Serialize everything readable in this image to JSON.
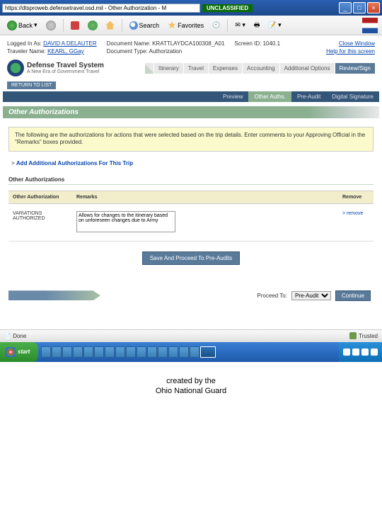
{
  "titlebar": {
    "address": "https://dtsproweb.defensetravel.osd.mil - Other Authorization - M",
    "classification": "UNCLASSIFIED"
  },
  "toolbar": {
    "back": "Back",
    "search": "Search",
    "favorites": "Favorites"
  },
  "topinfo": {
    "logged_label": "Logged In As:",
    "logged_value": "DAVID A DELAUTER",
    "traveler_label": "Traveler Name:",
    "traveler_value": "KEARL, GGay",
    "docname_label": "Document Name:",
    "docname_value": "KRATTLAYDCA100308_A01",
    "doctype_label": "Document Type:",
    "doctype_value": "Authorization",
    "screen_label": "Screen ID:",
    "screen_value": "1040.1",
    "close": "Close Window",
    "help": "Help for this screen"
  },
  "dts": {
    "title": "Defense Travel System",
    "sub": "A New Era of Government Travel",
    "return": "RETURN TO LIST"
  },
  "nav": {
    "itinerary": "Itinerary",
    "travel": "Travel",
    "expenses": "Expenses",
    "accounting": "Accounting",
    "additional": "Additional Options",
    "review": "Review/Sign"
  },
  "subnav": {
    "preview": "Preview",
    "other": "Other Auths.",
    "preaudit": "Pre-Audit",
    "signature": "Digital Signature"
  },
  "section": {
    "title": "Other Authorizations",
    "notice": "The following are the authorizations for actions that were selected based on the trip details. Enter comments to your Approving Official in the \"Remarks\" boxes provided.",
    "add_link": "Add Additional Authorizations For This Trip",
    "sub_title": "Other Authorizations"
  },
  "table": {
    "col1": "Other Authorization",
    "col2": "Remarks",
    "col3": "Remove",
    "row1_auth": "VARIATIONS AUTHORIZED",
    "row1_remarks": "Allows for changes to the itinerary based on unforeseen changes due to Army",
    "row1_remove": "> remove"
  },
  "buttons": {
    "save": "Save And Proceed To Pre-Audits",
    "proceed_label": "Proceed To:",
    "proceed_option": "Pre-Audit",
    "continue": "Continue"
  },
  "statusbar": {
    "done": "Done",
    "trusted": "Trusted"
  },
  "taskbar": {
    "start": "start"
  },
  "footer": {
    "line1": "created by the",
    "line2": "Ohio National Guard"
  }
}
